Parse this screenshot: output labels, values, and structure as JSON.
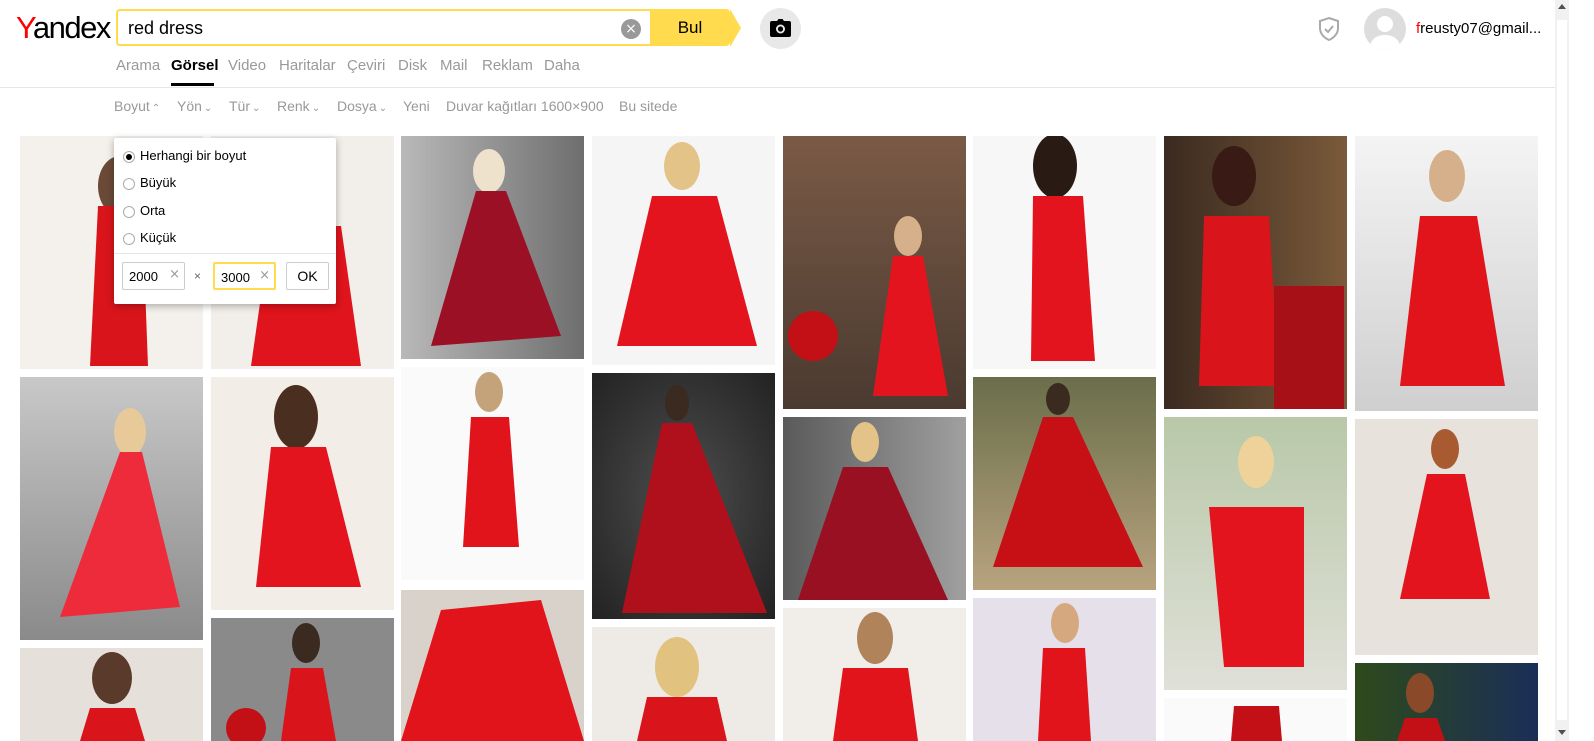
{
  "header": {
    "logo_first": "Y",
    "logo_rest": "andex",
    "search_value": "red dress",
    "find_label": "Bul",
    "user_first": "f",
    "user_rest": "reusty07@gmail..."
  },
  "tabs": [
    "Arama",
    "Görsel",
    "Video",
    "Haritalar",
    "Çeviri",
    "Disk",
    "Mail",
    "Reklam",
    "Daha"
  ],
  "active_tab": "Görsel",
  "filters": [
    "Boyut",
    "Yön",
    "Tür",
    "Renk",
    "Dosya",
    "Yeni",
    "Duvar kağıtları 1600×900",
    "Bu sitede"
  ],
  "size_dropdown": {
    "options": [
      "Herhangi bir boyut",
      "Büyük",
      "Orta",
      "Küçük"
    ],
    "selected": "Herhangi bir boyut",
    "width_value": "2000",
    "times_sign": "×",
    "height_value": "3000",
    "ok_label": "OK"
  },
  "colors": {
    "accent_yellow": "#ffdb4d",
    "brand_red": "#ff0000",
    "dress_red": "#d9141b"
  },
  "icons": [
    "clear-icon",
    "camera-icon",
    "shield-icon",
    "avatar-icon",
    "chevron-down-icon",
    "chevron-up-icon"
  ]
}
